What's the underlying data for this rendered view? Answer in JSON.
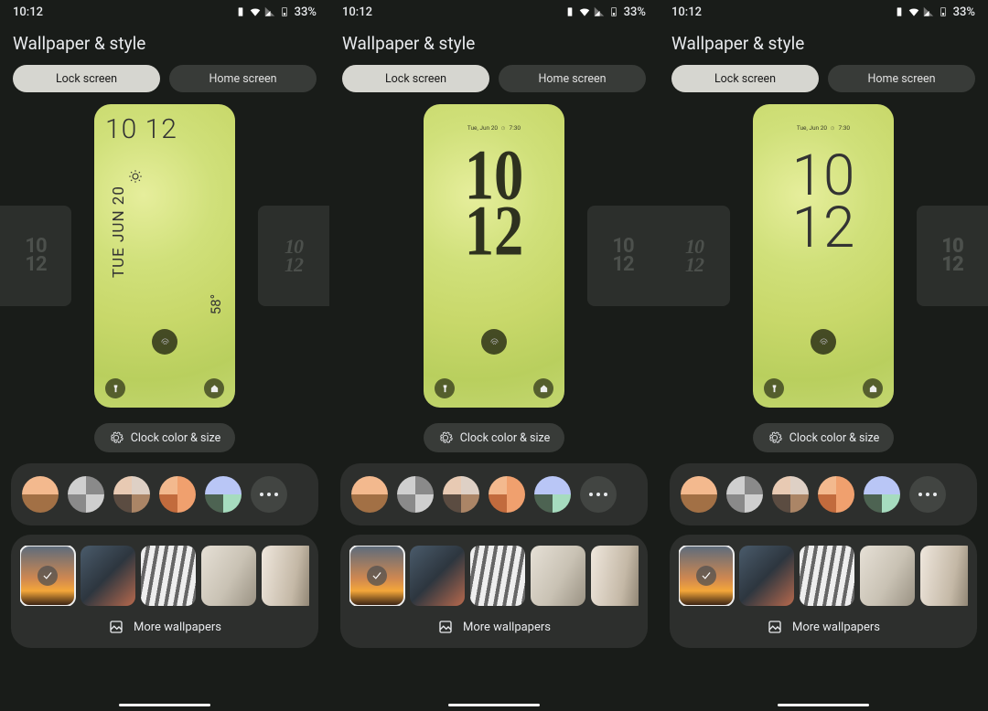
{
  "status": {
    "time": "10:12",
    "battery_pct": "33%"
  },
  "title": "Wallpaper & style",
  "tabs": {
    "lock": "Lock screen",
    "home": "Home screen"
  },
  "clock_color_size": "Clock color & size",
  "more_wallpapers": "More wallpapers",
  "mock": {
    "time_hh": "10",
    "time_mm": "12",
    "time_compact": "10 12",
    "date_long": "TUE JUN 20",
    "date_short": "Tue, Jun 20",
    "alarm": "7:30",
    "temp": "58°"
  },
  "swatches": [
    {
      "c1": "#f3b98e",
      "c2": "#f3b98e",
      "c3": "#a27045",
      "c4": "#a27045"
    },
    {
      "c1": "#cfcfcf",
      "c2": "#8a8a8a",
      "c3": "#8a8a8a",
      "c4": "#cfcfcf"
    },
    {
      "c1": "#e8cab3",
      "c2": "#ded0c5",
      "c3": "#5b4c41",
      "c4": "#ab8566"
    },
    {
      "c1": "#f3b98e",
      "c2": "#f0a06e",
      "c3": "#c26b3d",
      "c4": "#f0a06e"
    },
    {
      "c1": "#b9c6f6",
      "c2": "#b9c6f6",
      "c3": "#4d6352",
      "c4": "#a6dcbf"
    }
  ]
}
